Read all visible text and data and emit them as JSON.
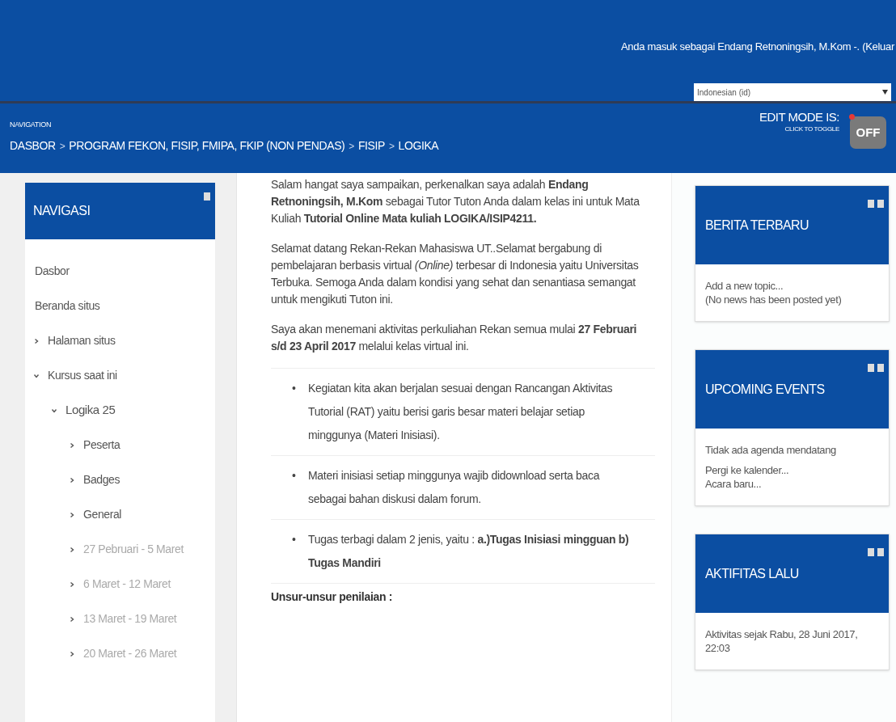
{
  "header": {
    "login_text": "Anda masuk sebagai Endang Retnoningsih, M.Kom -. (Keluar",
    "language": "Indonesian (id)"
  },
  "navbar": {
    "label": "NAVIGATION",
    "breadcrumb": [
      {
        "kind": "link",
        "text": "DASBOR"
      },
      {
        "kind": "separator",
        "text": ">"
      },
      {
        "kind": "link",
        "text": "PROGRAM FEKON, FISIP, FMIPA, FKIP (NON PENDAS)"
      },
      {
        "kind": "separator",
        "text": ">"
      },
      {
        "kind": "link",
        "text": "FISIP"
      },
      {
        "kind": "separator",
        "text": ">"
      },
      {
        "kind": "link",
        "text": "LOGIKA"
      }
    ],
    "edit_mode": {
      "title": "EDIT MODE IS:",
      "hint": "CLICK TO TOGGLE",
      "state_label": "OFF",
      "on": false
    }
  },
  "navigation_block": {
    "title": "NAVIGASI",
    "items": [
      {
        "label": "Dasbor",
        "dimmed": false,
        "bold": false
      },
      {
        "label": "Beranda situs",
        "dimmed": false,
        "bold": false
      },
      {
        "label": "Halaman situs",
        "dimmed": false,
        "bold": false,
        "expanded": false
      },
      {
        "label": "Kursus saat ini",
        "dimmed": false,
        "bold": false,
        "expanded": true,
        "children": [
          {
            "label": "Logika 25",
            "dimmed": false,
            "bold": true,
            "expanded": true,
            "children": [
              {
                "label": "Peserta",
                "dimmed": false,
                "bold": false,
                "expanded": false
              },
              {
                "label": "Badges",
                "dimmed": false,
                "bold": false,
                "expanded": false
              },
              {
                "label": "General",
                "dimmed": false,
                "bold": false,
                "expanded": false
              },
              {
                "label": "27 Pebruari - 5 Maret",
                "dimmed": true,
                "bold": false,
                "expanded": false
              },
              {
                "label": "6 Maret - 12 Maret",
                "dimmed": true,
                "bold": false,
                "expanded": false
              },
              {
                "label": "13 Maret - 19 Maret",
                "dimmed": true,
                "bold": false,
                "expanded": false
              },
              {
                "label": "20 Maret - 26 Maret",
                "dimmed": true,
                "bold": false,
                "expanded": false
              }
            ]
          }
        ]
      }
    ]
  },
  "content": {
    "paragraphs": [
      "Salam hangat saya sampaikan, perkenalkan saya adalah **Endang Retnoningsih, M.Kom** sebagai Tutor Tuton Anda dalam kelas ini untuk Mata Kuliah **Tutorial Online Mata kuliah LOGIKA/ISIP4211.**",
      "Selamat datang Rekan-Rekan Mahasiswa UT..Selamat bergabung di pembelajaran berbasis virtual *(Online)* terbesar di Indonesia yaitu Universitas Terbuka. Semoga Anda dalam kondisi yang sehat dan senantiasa semangat untuk mengikuti Tuton ini.",
      "Saya akan menemani aktivitas perkuliahan  Rekan semua mulai **27 Februari s/d 23 April 2017** melalui kelas virtual ini."
    ],
    "bullets": [
      {
        "bullet": "•",
        "text": "Kegiatan kita akan berjalan sesuai dengan  Rancangan Aktivitas Tutorial (RAT) yaitu berisi garis besar materi belajar setiap minggunya (Materi Inisiasi)."
      },
      {
        "bullet": "•",
        "text": "Materi inisiasi setiap minggunya wajib didownload serta baca sebagai bahan diskusi dalam forum."
      },
      {
        "bullet": "•",
        "text": "Tugas terbagi dalam 2 jenis, yaitu : **a.)Tugas Inisiasi mingguan b) Tugas Mandiri**"
      }
    ],
    "subheading": "Unsur-unsur penilaian :"
  },
  "blocks": [
    {
      "title": "BERITA TERBARU",
      "groups": [
        [
          "Add a new topic...",
          "(No news has been posted yet)"
        ]
      ]
    },
    {
      "title": "UPCOMING EVENTS",
      "groups": [
        [
          "Tidak ada agenda mendatang"
        ],
        [
          "Pergi ke kalender...",
          "Acara baru..."
        ]
      ]
    },
    {
      "title": "AKTIFITAS LALU",
      "groups": [
        [
          "Aktivitas sejak Rabu, 28 Juni 2017, 22:03"
        ]
      ]
    }
  ]
}
